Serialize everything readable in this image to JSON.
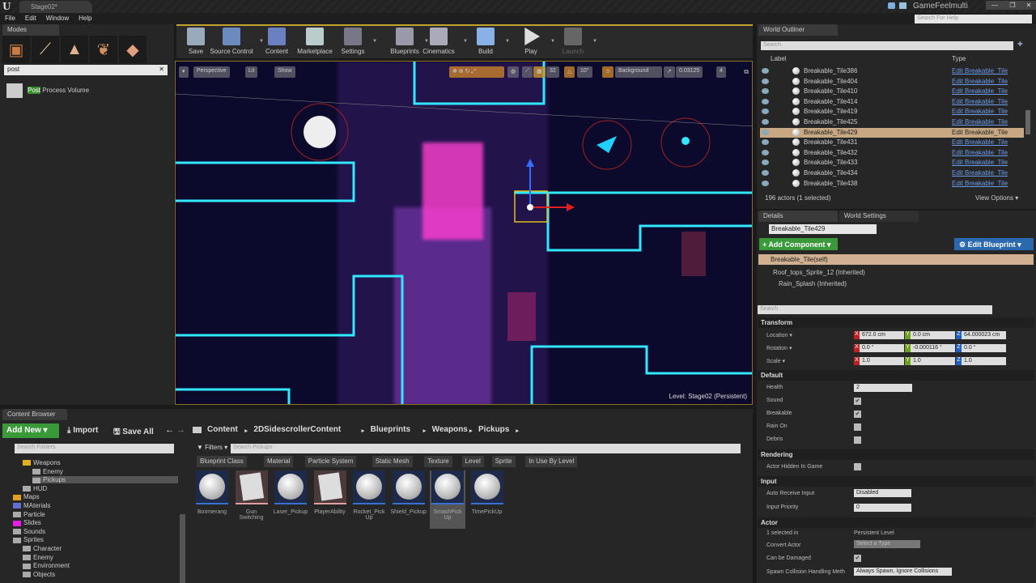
{
  "window": {
    "logo": "U",
    "doc_tab": "Stage02*",
    "app_name": "GameFeelmulti",
    "controls": [
      "—",
      "❐",
      "✕"
    ]
  },
  "menu": [
    "File",
    "Edit",
    "Window",
    "Help"
  ],
  "help_search_placeholder": "Search For Help",
  "modes": {
    "tab": "Modes",
    "search_value": "post",
    "result_highlight": "Post",
    "result_rest": " Process Volume"
  },
  "toolbar": [
    {
      "label": "Save",
      "color": "#9ab"
    },
    {
      "label": "Source Control",
      "color": "#6a8ac0"
    },
    {
      "label": "Content",
      "color": "#6a80c0"
    },
    {
      "label": "Marketplace",
      "color": "#bcc"
    },
    {
      "label": "Settings",
      "color": "#778"
    },
    {
      "label": "Blueprints",
      "color": "#99a"
    },
    {
      "label": "Cinematics",
      "color": "#aab"
    },
    {
      "label": "Build",
      "color": "#8ab0e8"
    },
    {
      "label": "Play",
      "color": "#ddd"
    },
    {
      "label": "Launch",
      "color": "#666"
    }
  ],
  "viewport": {
    "perspective": "Perspective",
    "lit": "Lit",
    "show": "Show",
    "grid_snap": "32",
    "rot_snap": "10°",
    "background": "Background",
    "scale_snap": "0.03125",
    "camera_speed": "4",
    "level_label": "Level:  Stage02 (Persistent)"
  },
  "outliner": {
    "tab": "World Outliner",
    "search_placeholder": "Search",
    "col_label": "Label",
    "col_type": "Type",
    "rows": [
      {
        "label": "Breakable_Tile386",
        "type": "Edit Breakable_Tile"
      },
      {
        "label": "Breakable_Tile404",
        "type": "Edit Breakable_Tile"
      },
      {
        "label": "Breakable_Tile410",
        "type": "Edit Breakable_Tile"
      },
      {
        "label": "Breakable_Tile414",
        "type": "Edit Breakable_Tile"
      },
      {
        "label": "Breakable_Tile419",
        "type": "Edit Breakable_Tile"
      },
      {
        "label": "Breakable_Tile425",
        "type": "Edit Breakable_Tile"
      },
      {
        "label": "Breakable_Tile429",
        "type": "Edit Breakable_Tile",
        "selected": true
      },
      {
        "label": "Breakable_Tile431",
        "type": "Edit Breakable_Tile"
      },
      {
        "label": "Breakable_Tile432",
        "type": "Edit Breakable_Tile"
      },
      {
        "label": "Breakable_Tile433",
        "type": "Edit Breakable_Tile"
      },
      {
        "label": "Breakable_Tile434",
        "type": "Edit Breakable_Tile"
      },
      {
        "label": "Breakable_Tile438",
        "type": "Edit Breakable_Tile"
      }
    ],
    "status": "196 actors (1 selected)",
    "view_options": "View Options ▾"
  },
  "details": {
    "tab": "Details",
    "tab2": "World Settings",
    "name": "Breakable_Tile429",
    "add_component": "+ Add Component ▾",
    "edit_blueprint": "⚙ Edit Blueprint ▾",
    "components": {
      "self": "Breakable_Tile(self)",
      "child1": "Roof_tops_Sprite_12 (Inherited)",
      "child2": "Rain_Splash (Inherited)"
    },
    "search_placeholder": "Search",
    "transform": {
      "title": "Transform",
      "location": "Location ▾",
      "rotation": "Rotation ▾",
      "scale": "Scale ▾",
      "loc": [
        "672.0 cm",
        "0.0 cm",
        "64.000023 cm"
      ],
      "rot": [
        "0.0 °",
        "-0.000116 °",
        "0.0 °"
      ],
      "scl": [
        "1.0",
        "1.0",
        "1.0"
      ]
    },
    "default": {
      "title": "Default",
      "health_label": "Health",
      "health": "2",
      "sound": "Sound",
      "sound_checked": true,
      "breakable": "Breakable",
      "breakable_checked": true,
      "rain_on": "Rain On",
      "rain_checked": false,
      "debris": "Debris",
      "debris_checked": false
    },
    "rendering": {
      "title": "Rendering",
      "hidden": "Actor Hidden In Game",
      "hidden_checked": false
    },
    "input": {
      "title": "Input",
      "auto_receive": "Auto Receive Input",
      "auto_value": "Disabled",
      "priority": "Input Priority",
      "priority_value": "0"
    },
    "actor": {
      "title": "Actor",
      "selected_in": "1 selected in",
      "level": "Persistent Level",
      "convert": "Convert Actor",
      "convert_value": "Select a Type",
      "damaged": "Can be Damaged",
      "damaged_checked": true,
      "spawn": "Spawn Collision Handling Meth",
      "spawn_value": "Always Spawn, Ignore Collisions"
    }
  },
  "content_browser": {
    "tab": "Content Browser",
    "add_new": "Add New ▾",
    "import": "⤓ Import",
    "save_all": "🖫 Save All",
    "breadcrumbs": [
      "Content",
      "2DSidescrollerContent",
      "Blueprints",
      "Weapons",
      "Pickups"
    ],
    "search_folders": "Search Folders",
    "filters": "▼ Filters ▾",
    "search_assets": "Search Pickups",
    "folders": [
      {
        "name": "Weapons",
        "indent": 2,
        "color": "#e0b020",
        "open": true
      },
      {
        "name": "Enemy",
        "indent": 3,
        "color": "#aaa"
      },
      {
        "name": "Pickups",
        "indent": 3,
        "color": "#aaa",
        "selected": true
      },
      {
        "name": "HUD",
        "indent": 2,
        "color": "#aaa"
      },
      {
        "name": "Maps",
        "indent": 1,
        "color": "#e0a020"
      },
      {
        "name": "MAterials",
        "indent": 1,
        "color": "#6070d0"
      },
      {
        "name": "Particle",
        "indent": 1,
        "color": "#aaa"
      },
      {
        "name": "Slides",
        "indent": 1,
        "color": "#e020e0"
      },
      {
        "name": "Sounds",
        "indent": 1,
        "color": "#aaa"
      },
      {
        "name": "Sprites",
        "indent": 1,
        "color": "#aaa",
        "open": true
      },
      {
        "name": "Character",
        "indent": 2,
        "color": "#aaa"
      },
      {
        "name": "Enemy",
        "indent": 2,
        "color": "#aaa"
      },
      {
        "name": "Environment",
        "indent": 2,
        "color": "#aaa"
      },
      {
        "name": "Objects",
        "indent": 2,
        "color": "#aaa"
      }
    ],
    "filter_chips": [
      "Blueprint Class",
      "Material",
      "Particle System",
      "Static Mesh",
      "Texture",
      "Level",
      "Sprite",
      "In Use By Level"
    ],
    "assets": [
      {
        "name": "Boomerang",
        "kind": "sphere"
      },
      {
        "name": "Gun Switching",
        "kind": "doc"
      },
      {
        "name": "Laser_Pickup",
        "kind": "sphere"
      },
      {
        "name": "PlayerAbility",
        "kind": "doc"
      },
      {
        "name": "Rocket_Pick Up",
        "kind": "sphere"
      },
      {
        "name": "Shield_Pickup",
        "kind": "sphere"
      },
      {
        "name": "SmashPick Up",
        "kind": "sphere",
        "selected": true
      },
      {
        "name": "TimePickUp",
        "kind": "sphere"
      }
    ]
  }
}
